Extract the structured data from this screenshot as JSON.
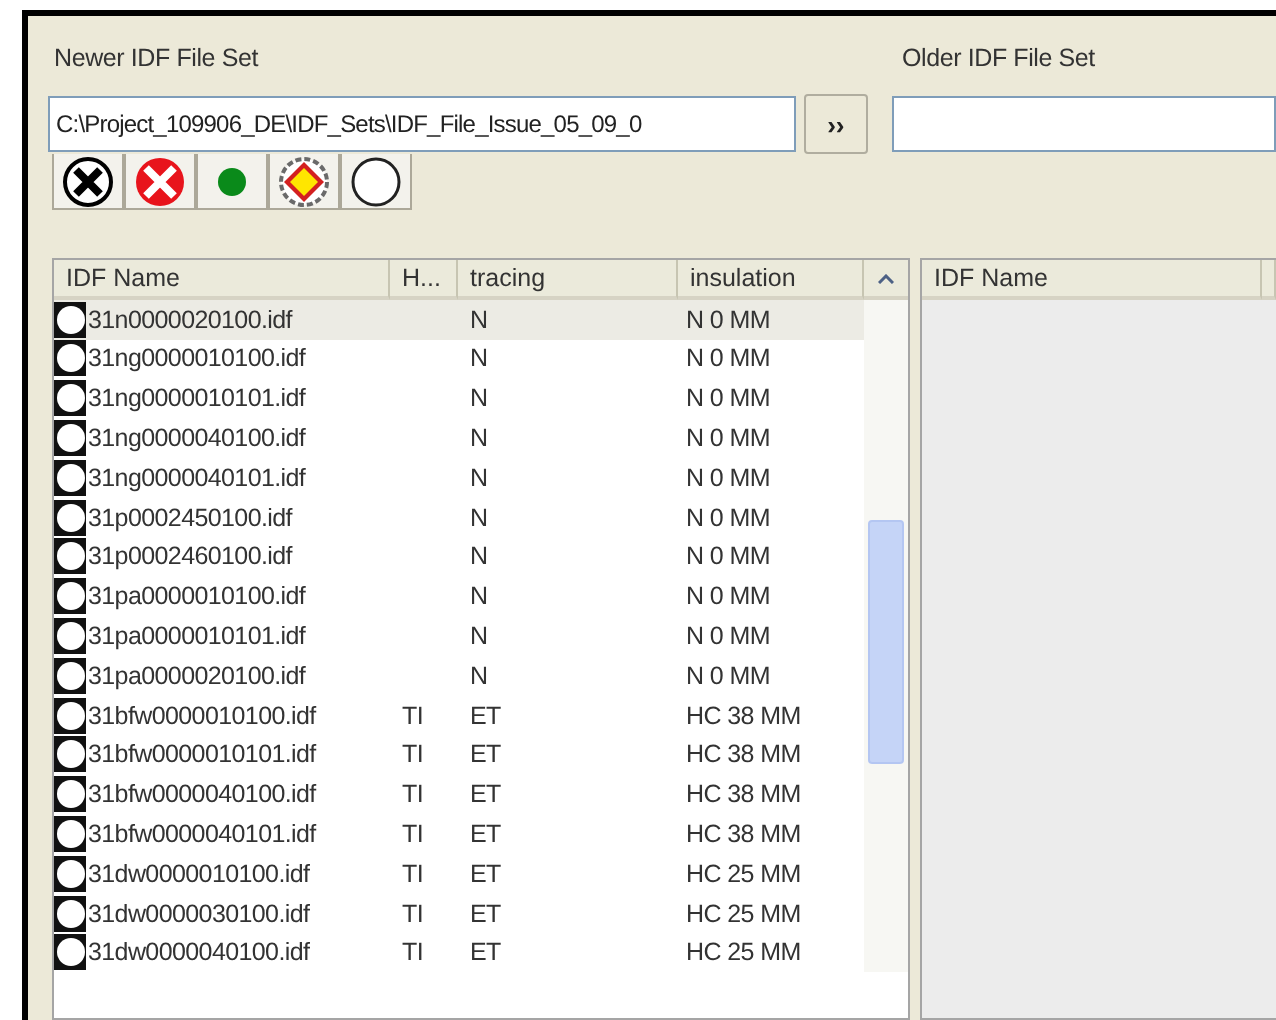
{
  "newer_set": {
    "label": "Newer IDF File Set",
    "path": "C:\\Project_109906_DE\\IDF_Sets\\IDF_File_Issue_05_09_0",
    "load_button": "››"
  },
  "older_set": {
    "label": "Older IDF File Set"
  },
  "toolbar": [
    {
      "kind": "black-x"
    },
    {
      "kind": "red-x"
    },
    {
      "kind": "green-dot"
    },
    {
      "kind": "yellow-gear"
    },
    {
      "kind": "empty"
    }
  ],
  "newer_list": {
    "columns": [
      "IDF Name",
      "H...",
      "tracing",
      "insulation"
    ],
    "rows": [
      {
        "name": "31n0000020100.idf",
        "tracing": "N",
        "insulation": "N 0 MM",
        "selected": true
      },
      {
        "name": "31ng0000010100.idf",
        "tracing": "N",
        "insulation": "N 0 MM",
        "selected": false
      },
      {
        "name": "31ng0000010101.idf",
        "tracing": "N",
        "insulation": "N 0 MM",
        "selected": false
      },
      {
        "name": "31ng0000040100.idf",
        "tracing": "N",
        "insulation": "N 0 MM",
        "selected": false
      },
      {
        "name": "31ng0000040101.idf",
        "tracing": "N",
        "insulation": "N 0 MM",
        "selected": false
      },
      {
        "name": "31p0002450100.idf",
        "tracing": "N",
        "insulation": "N 0 MM",
        "selected": false
      },
      {
        "name": "31p0002460100.idf",
        "tracing": "N",
        "insulation": "N 0 MM",
        "selected": false
      },
      {
        "name": "31pa0000010100.idf",
        "tracing": "N",
        "insulation": "N 0 MM",
        "selected": false
      },
      {
        "name": "31pa0000010101.idf",
        "tracing": "N",
        "insulation": "N 0 MM",
        "selected": false
      },
      {
        "name": "31pa0000020100.idf",
        "tracing": "N",
        "insulation": "N 0 MM",
        "selected": false
      },
      {
        "name": "31bfw0000010100.idf",
        "h": "TI",
        "tracing": "ET",
        "insulation": "HC 38 MM",
        "selected": false
      },
      {
        "name": "31bfw0000010101.idf",
        "h": "TI",
        "tracing": "ET",
        "insulation": "HC 38 MM",
        "selected": false
      },
      {
        "name": "31bfw0000040100.idf",
        "h": "TI",
        "tracing": "ET",
        "insulation": "HC 38 MM",
        "selected": false
      },
      {
        "name": "31bfw0000040101.idf",
        "h": "TI",
        "tracing": "ET",
        "insulation": "HC 38 MM",
        "selected": false
      },
      {
        "name": "31dw0000010100.idf",
        "h": "TI",
        "tracing": "ET",
        "insulation": "HC 25 MM",
        "selected": false
      },
      {
        "name": "31dw0000030100.idf",
        "h": "TI",
        "tracing": "ET",
        "insulation": "HC 25 MM",
        "selected": false
      },
      {
        "name": "31dw0000040100.idf",
        "h": "TI",
        "tracing": "ET",
        "insulation": "HC 25 MM",
        "selected": false
      }
    ]
  },
  "older_list": {
    "columns": [
      "IDF Name"
    ]
  }
}
